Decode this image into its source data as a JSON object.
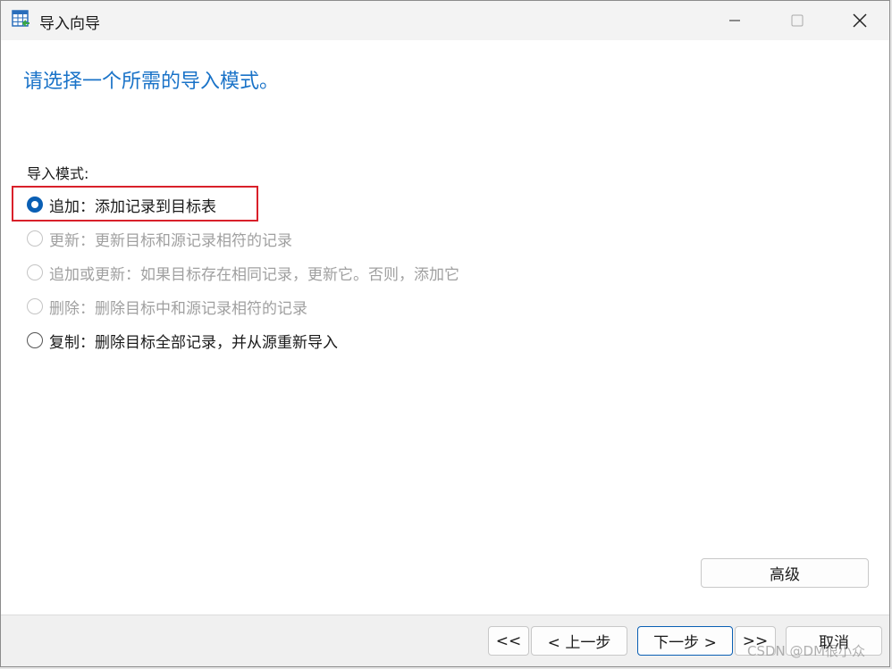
{
  "window": {
    "title": "导入向导",
    "icon": "table-import-icon"
  },
  "heading": "请选择一个所需的导入模式。",
  "mode_label": "导入模式:",
  "options": [
    {
      "label": "追加：添加记录到目标表",
      "selected": true,
      "enabled": true
    },
    {
      "label": "更新：更新目标和源记录相符的记录",
      "selected": false,
      "enabled": false
    },
    {
      "label": "追加或更新：如果目标存在相同记录，更新它。否则，添加它",
      "selected": false,
      "enabled": false
    },
    {
      "label": "删除：删除目标中和源记录相符的记录",
      "selected": false,
      "enabled": false
    },
    {
      "label": "复制：删除目标全部记录，并从源重新导入",
      "selected": false,
      "enabled": true
    }
  ],
  "buttons": {
    "advanced": "高级",
    "first": "<<",
    "prev": "< 上一步",
    "next": "下一步 >",
    "last": ">>",
    "cancel": "取消"
  },
  "watermark": "CSDN @DM很小众",
  "colors": {
    "accent": "#0a5fb4",
    "heading": "#1a73c8",
    "highlight": "#d9202a"
  }
}
